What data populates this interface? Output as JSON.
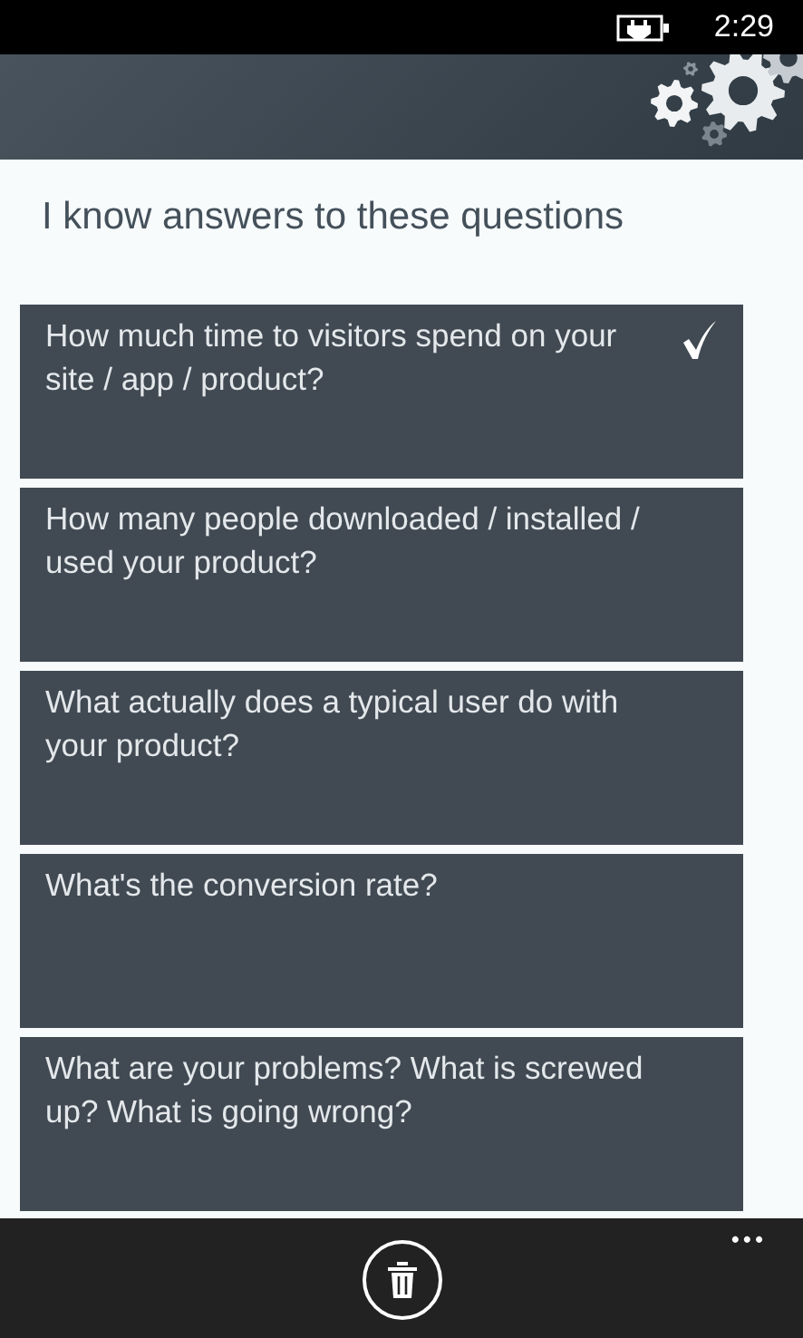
{
  "status_bar": {
    "time": "2:29"
  },
  "heading": "I know answers to these questions",
  "questions": [
    {
      "text": "How much time to visitors spend on your site / app / product?",
      "checked": true
    },
    {
      "text": "How many people downloaded / installed / used your product?",
      "checked": false
    },
    {
      "text": "What actually does a typical user do with your product?",
      "checked": false
    },
    {
      "text": "What's the conversion rate?",
      "checked": false
    },
    {
      "text": "What are your problems? What is screwed up? What is going wrong?",
      "checked": false
    }
  ],
  "app_bar": {
    "more": "•••"
  }
}
